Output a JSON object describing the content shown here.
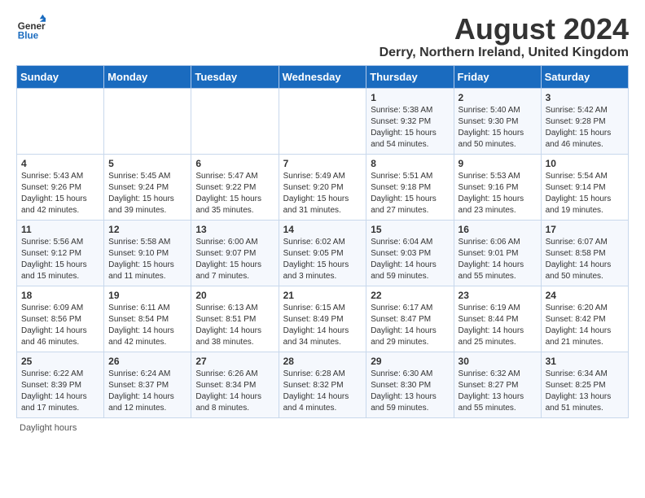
{
  "logo": {
    "general": "General",
    "blue": "Blue"
  },
  "title": "August 2024",
  "subtitle": "Derry, Northern Ireland, United Kingdom",
  "days_of_week": [
    "Sunday",
    "Monday",
    "Tuesday",
    "Wednesday",
    "Thursday",
    "Friday",
    "Saturday"
  ],
  "weeks": [
    [
      {
        "day": "",
        "info": ""
      },
      {
        "day": "",
        "info": ""
      },
      {
        "day": "",
        "info": ""
      },
      {
        "day": "",
        "info": ""
      },
      {
        "day": "1",
        "info": "Sunrise: 5:38 AM\nSunset: 9:32 PM\nDaylight: 15 hours and 54 minutes."
      },
      {
        "day": "2",
        "info": "Sunrise: 5:40 AM\nSunset: 9:30 PM\nDaylight: 15 hours and 50 minutes."
      },
      {
        "day": "3",
        "info": "Sunrise: 5:42 AM\nSunset: 9:28 PM\nDaylight: 15 hours and 46 minutes."
      }
    ],
    [
      {
        "day": "4",
        "info": "Sunrise: 5:43 AM\nSunset: 9:26 PM\nDaylight: 15 hours and 42 minutes."
      },
      {
        "day": "5",
        "info": "Sunrise: 5:45 AM\nSunset: 9:24 PM\nDaylight: 15 hours and 39 minutes."
      },
      {
        "day": "6",
        "info": "Sunrise: 5:47 AM\nSunset: 9:22 PM\nDaylight: 15 hours and 35 minutes."
      },
      {
        "day": "7",
        "info": "Sunrise: 5:49 AM\nSunset: 9:20 PM\nDaylight: 15 hours and 31 minutes."
      },
      {
        "day": "8",
        "info": "Sunrise: 5:51 AM\nSunset: 9:18 PM\nDaylight: 15 hours and 27 minutes."
      },
      {
        "day": "9",
        "info": "Sunrise: 5:53 AM\nSunset: 9:16 PM\nDaylight: 15 hours and 23 minutes."
      },
      {
        "day": "10",
        "info": "Sunrise: 5:54 AM\nSunset: 9:14 PM\nDaylight: 15 hours and 19 minutes."
      }
    ],
    [
      {
        "day": "11",
        "info": "Sunrise: 5:56 AM\nSunset: 9:12 PM\nDaylight: 15 hours and 15 minutes."
      },
      {
        "day": "12",
        "info": "Sunrise: 5:58 AM\nSunset: 9:10 PM\nDaylight: 15 hours and 11 minutes."
      },
      {
        "day": "13",
        "info": "Sunrise: 6:00 AM\nSunset: 9:07 PM\nDaylight: 15 hours and 7 minutes."
      },
      {
        "day": "14",
        "info": "Sunrise: 6:02 AM\nSunset: 9:05 PM\nDaylight: 15 hours and 3 minutes."
      },
      {
        "day": "15",
        "info": "Sunrise: 6:04 AM\nSunset: 9:03 PM\nDaylight: 14 hours and 59 minutes."
      },
      {
        "day": "16",
        "info": "Sunrise: 6:06 AM\nSunset: 9:01 PM\nDaylight: 14 hours and 55 minutes."
      },
      {
        "day": "17",
        "info": "Sunrise: 6:07 AM\nSunset: 8:58 PM\nDaylight: 14 hours and 50 minutes."
      }
    ],
    [
      {
        "day": "18",
        "info": "Sunrise: 6:09 AM\nSunset: 8:56 PM\nDaylight: 14 hours and 46 minutes."
      },
      {
        "day": "19",
        "info": "Sunrise: 6:11 AM\nSunset: 8:54 PM\nDaylight: 14 hours and 42 minutes."
      },
      {
        "day": "20",
        "info": "Sunrise: 6:13 AM\nSunset: 8:51 PM\nDaylight: 14 hours and 38 minutes."
      },
      {
        "day": "21",
        "info": "Sunrise: 6:15 AM\nSunset: 8:49 PM\nDaylight: 14 hours and 34 minutes."
      },
      {
        "day": "22",
        "info": "Sunrise: 6:17 AM\nSunset: 8:47 PM\nDaylight: 14 hours and 29 minutes."
      },
      {
        "day": "23",
        "info": "Sunrise: 6:19 AM\nSunset: 8:44 PM\nDaylight: 14 hours and 25 minutes."
      },
      {
        "day": "24",
        "info": "Sunrise: 6:20 AM\nSunset: 8:42 PM\nDaylight: 14 hours and 21 minutes."
      }
    ],
    [
      {
        "day": "25",
        "info": "Sunrise: 6:22 AM\nSunset: 8:39 PM\nDaylight: 14 hours and 17 minutes."
      },
      {
        "day": "26",
        "info": "Sunrise: 6:24 AM\nSunset: 8:37 PM\nDaylight: 14 hours and 12 minutes."
      },
      {
        "day": "27",
        "info": "Sunrise: 6:26 AM\nSunset: 8:34 PM\nDaylight: 14 hours and 8 minutes."
      },
      {
        "day": "28",
        "info": "Sunrise: 6:28 AM\nSunset: 8:32 PM\nDaylight: 14 hours and 4 minutes."
      },
      {
        "day": "29",
        "info": "Sunrise: 6:30 AM\nSunset: 8:30 PM\nDaylight: 13 hours and 59 minutes."
      },
      {
        "day": "30",
        "info": "Sunrise: 6:32 AM\nSunset: 8:27 PM\nDaylight: 13 hours and 55 minutes."
      },
      {
        "day": "31",
        "info": "Sunrise: 6:34 AM\nSunset: 8:25 PM\nDaylight: 13 hours and 51 minutes."
      }
    ]
  ],
  "footer": "Daylight hours"
}
